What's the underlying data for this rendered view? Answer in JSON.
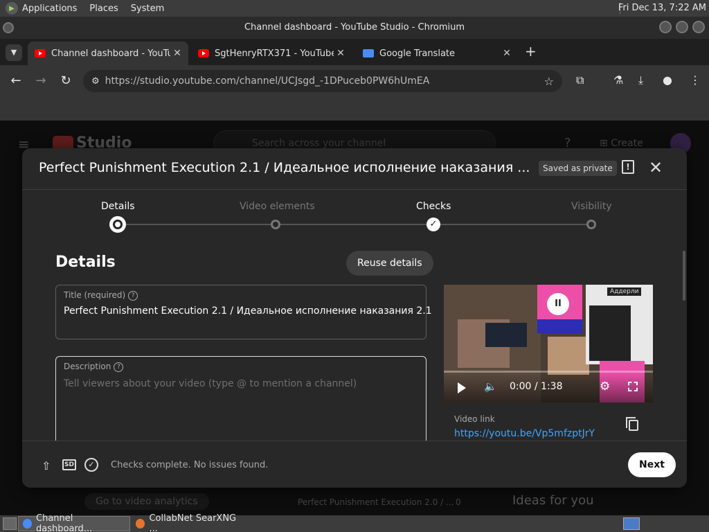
{
  "os_panel": {
    "menus": [
      "Applications",
      "Places",
      "System"
    ],
    "clock": "Fri Dec 13,  7:22 AM"
  },
  "window": {
    "title": "Channel dashboard - YouTube Studio - Chromium"
  },
  "tabs": [
    {
      "label": "Channel dashboard - YouTube Studio",
      "active": true
    },
    {
      "label": "SgtHenryRTX371 - YouTube",
      "active": false
    },
    {
      "label": "Google Translate",
      "active": false
    }
  ],
  "toolbar": {
    "url": "https://studio.youtube.com/channel/UCJsgd_-1DPuceb0PW6hUmEA"
  },
  "background": {
    "logo_text": "Studio",
    "search_placeholder": "Search across your channel",
    "create_label": "Create",
    "analytics_label": "Go to video analytics",
    "video_row_title": "Perfect Punishment Execution 2.0 / ...",
    "video_row_count": "0",
    "ideas_heading": "Ideas for you"
  },
  "modal": {
    "title": "Perfect Punishment Execution 2.1 / Идеальное исполнение наказания ...",
    "saved_badge": "Saved as private",
    "steps": [
      {
        "label": "Details",
        "state": "current"
      },
      {
        "label": "Video elements",
        "state": "pending"
      },
      {
        "label": "Checks",
        "state": "done"
      },
      {
        "label": "Visibility",
        "state": "pending"
      }
    ],
    "details_heading": "Details",
    "reuse_button": "Reuse details",
    "title_field": {
      "label": "Title (required)",
      "value": "Perfect Punishment Execution 2.1 / Идеальное исполнение наказания 2.1"
    },
    "description_field": {
      "label": "Description",
      "placeholder": "Tell viewers about your video (type @ to mention a channel)"
    },
    "video": {
      "time": "0:00 / 1:38",
      "overlay_tag": "Аддерли",
      "link_label": "Video link",
      "link_url": "https://youtu.be/Vp5mfzptJrY"
    },
    "footer": {
      "sd_label": "SD",
      "checks_status": "Checks complete. No issues found.",
      "next_button": "Next"
    }
  },
  "taskbar": {
    "tasks": [
      {
        "label": "Channel dashboard...",
        "active": true
      },
      {
        "label": "CollabNet SearXNG ...",
        "active": false
      }
    ]
  }
}
